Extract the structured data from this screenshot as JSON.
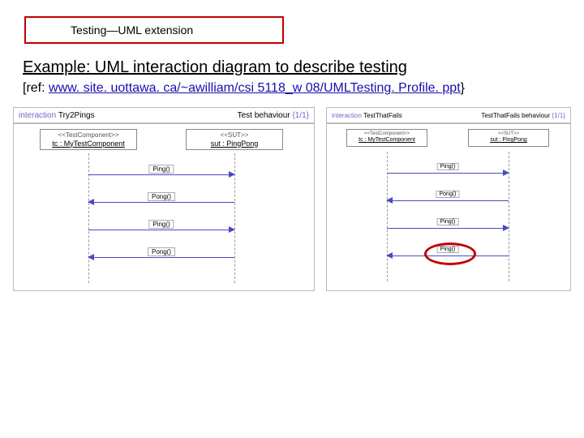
{
  "title_box": "Testing—UML extension",
  "heading": "Example:  UML interaction diagram to describe testing",
  "ref_prefix": "[ref: ",
  "ref_link": "www. site. uottawa. ca/~awilliam/csi 5118_w 08/UMLTesting. Profile. ppt",
  "ref_suffix": "}",
  "diagrams": {
    "left": {
      "header": {
        "kind": "interaction",
        "name": "Try2Pings",
        "right_label": "Test behaviour",
        "page": "{1/1}"
      },
      "lifelines": [
        {
          "stereo": "<<TestComponent>>",
          "name": "tc : MyTestComponent"
        },
        {
          "stereo": "<<SUT>>",
          "name": "sut : PingPong"
        }
      ],
      "messages": [
        {
          "label": "Ping()",
          "dir": "r"
        },
        {
          "label": "Pong()",
          "dir": "l"
        },
        {
          "label": "Ping()",
          "dir": "r"
        },
        {
          "label": "Pong()",
          "dir": "l"
        }
      ]
    },
    "right": {
      "header": {
        "kind": "interaction",
        "name": "TestThatFails",
        "right_label": "TestThatFails behaviour",
        "page": "{1/1}"
      },
      "lifelines": [
        {
          "stereo": "<<TestComponent>>",
          "name": "tc : MyTestComponent"
        },
        {
          "stereo": "<<SUT>>",
          "name": "sut : PingPong"
        }
      ],
      "messages": [
        {
          "label": "Ping()",
          "dir": "r"
        },
        {
          "label": "Pong()",
          "dir": "l"
        },
        {
          "label": "Ping()",
          "dir": "r"
        },
        {
          "label": "Ping()",
          "dir": "l"
        }
      ]
    }
  }
}
